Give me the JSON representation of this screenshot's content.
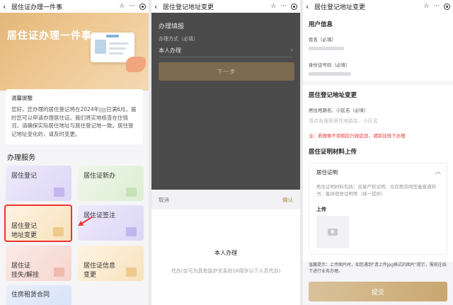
{
  "screen1": {
    "topbar": {
      "title": "居住证办理一件事"
    },
    "hero": {
      "title": "居住证办理一件事"
    },
    "notice": {
      "title": "温馨提醒",
      "body_pre": "您好，您办理的居住登记将在2024年",
      "body_post": "日满6月。届时您可以申请办理居住证。我们将实地核查在住情况，请确保实际居住地址与居住登记地一致。居住登记地址变化的，请及时变更。"
    },
    "section_title": "办理服务",
    "services": [
      {
        "label": "居住登记"
      },
      {
        "label": "居住证新办"
      },
      {
        "label": "居住登记\n地址变更"
      },
      {
        "label": "居住证签注"
      },
      {
        "label": "居住证\n挂失/解挂"
      },
      {
        "label": "居住证信息\n变更"
      },
      {
        "label": "住房租赁合同"
      }
    ]
  },
  "screen2": {
    "topbar": {
      "title": "居住登记地址变更"
    },
    "form": {
      "title": "办理填报",
      "method_label": "办理方式（必填）",
      "method_value": "本人办理",
      "next": "下一步"
    },
    "sheet": {
      "cancel": "取消",
      "confirm": "确认",
      "options": [
        "本人办理",
        "代办(仅可为具有监护关系的16周岁以下人员代办)"
      ]
    }
  },
  "screen3": {
    "topbar": {
      "title": "居住登记地址变更"
    },
    "user_section": "用户信息",
    "name_label": "姓名（必填）",
    "id_label": "身份证号码（必填）",
    "address_section": "居住登记地址变更",
    "address_label": "居住地路名、小区名（必填）",
    "address_placeholder": "请点击搜索居住地路名、小区名",
    "warning": "注：若搜索不到相应行政区划，请前往线下办理",
    "upload_section": "居住证明材料上传",
    "proof": {
      "title": "居住证明",
      "desc": "居住证明材料包括：房屋产权证明、住房租赁网签备案通知书、集体宿舍证明等（择一提供）",
      "upload_label": "上传"
    },
    "tip": "温馨提示：上传图片时，如您遇到\"请上传jpg格式的图片\"提示，需前往线下进行业务办理。",
    "submit": "提交"
  }
}
